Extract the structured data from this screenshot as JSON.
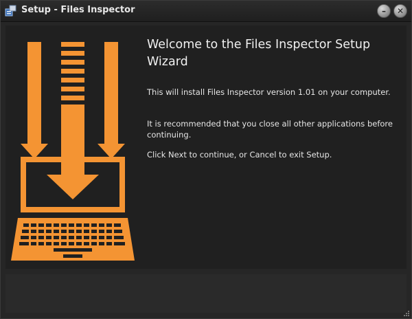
{
  "window": {
    "title": "Setup - Files Inspector",
    "icons": {
      "app": "setup-app-icon",
      "minimize": "minimize-icon",
      "close": "close-icon"
    },
    "minimize_glyph": "–",
    "close_glyph": "✕"
  },
  "wizard": {
    "illustration": "download-to-laptop-illustration",
    "accent_color": "#f49433",
    "heading": "Welcome to the Files Inspector Setup Wizard",
    "paragraphs": [
      "This will install Files Inspector version 1.01 on your computer.",
      "It is recommended that you close all other applications before continuing.",
      "Click Next to continue, or Cancel to exit Setup."
    ]
  }
}
